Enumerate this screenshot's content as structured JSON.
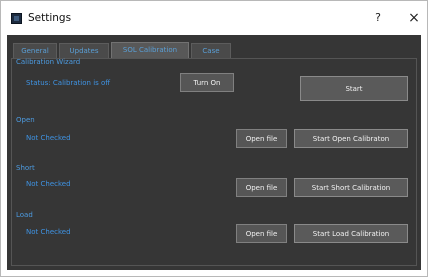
{
  "window": {
    "title": "Settings",
    "help_label": "?",
    "close_label": "×"
  },
  "tabs": [
    {
      "label": "General"
    },
    {
      "label": "Updates"
    },
    {
      "label": "SOL Calibration"
    },
    {
      "label": "Case"
    }
  ],
  "active_tab": "SOL Calibration",
  "calibration": {
    "section_title": "Calibration Wizard",
    "status": "Status: Calibration is off",
    "turn_on_label": "Turn On",
    "start_label": "Start"
  },
  "open": {
    "section_title": "Open",
    "status": "Not Checked",
    "open_file_label": "Open file",
    "start_label": "Start Open Calibraton"
  },
  "short": {
    "section_title": "Short",
    "status": "Not Checked",
    "open_file_label": "Open file",
    "start_label": "Start Short Calibration"
  },
  "load": {
    "section_title": "Load",
    "status": "Not Checked",
    "open_file_label": "Open file",
    "start_label": "Start Load Calibration"
  },
  "colors": {
    "panel_bg": "#363636",
    "accent_text": "#3f93e3",
    "button_bg": "#565656"
  }
}
